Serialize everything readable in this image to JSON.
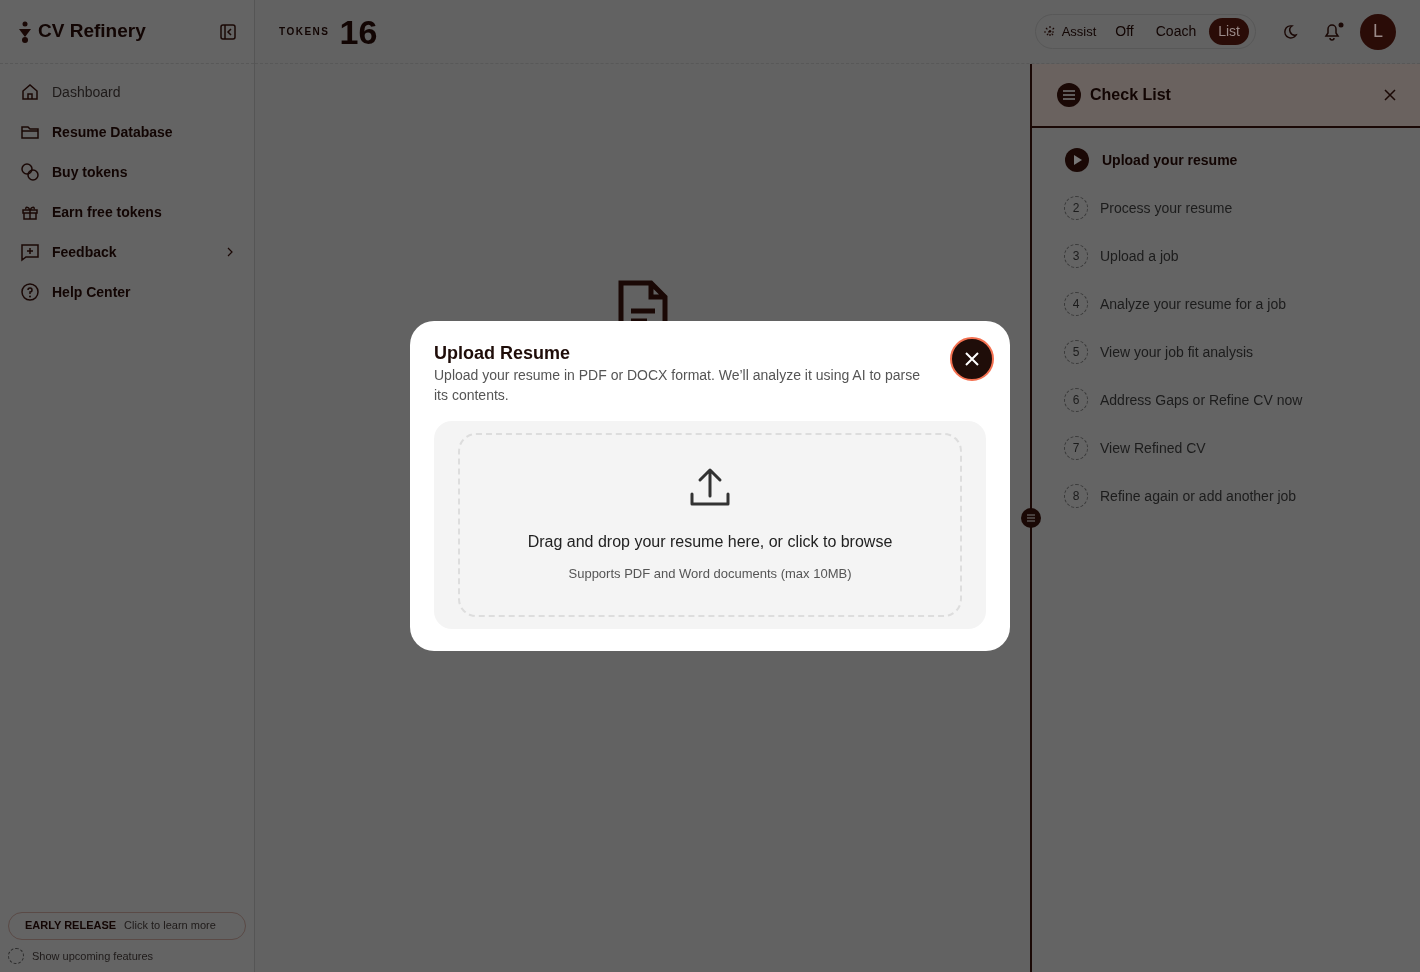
{
  "app": {
    "name": "CV Refinery"
  },
  "tokens": {
    "label": "TOKENS",
    "count": "16"
  },
  "sidebar": {
    "items": [
      {
        "label": "Dashboard",
        "selected": true,
        "has_submenu": false
      },
      {
        "label": "Resume Database",
        "selected": false,
        "has_submenu": false
      },
      {
        "label": "Buy tokens",
        "selected": false,
        "has_submenu": false
      },
      {
        "label": "Earn free tokens",
        "selected": false,
        "has_submenu": false
      },
      {
        "label": "Feedback",
        "selected": false,
        "has_submenu": true
      },
      {
        "label": "Help Center",
        "selected": false,
        "has_submenu": false
      }
    ]
  },
  "assist": {
    "label": "Assist",
    "options": [
      {
        "label": "Off",
        "selected": false
      },
      {
        "label": "Coach",
        "selected": false
      },
      {
        "label": "List",
        "selected": true
      }
    ]
  },
  "notifications": {
    "unread": true
  },
  "avatar": {
    "initial": "L"
  },
  "checklist": {
    "title": "Check List",
    "steps": [
      {
        "label": "Upload your resume",
        "current": true
      },
      {
        "number": "2",
        "label": "Process your resume",
        "current": false
      },
      {
        "number": "3",
        "label": "Upload a job",
        "current": false
      },
      {
        "number": "4",
        "label": "Analyze your resume for a job",
        "current": false
      },
      {
        "number": "5",
        "label": "View your job fit analysis",
        "current": false
      },
      {
        "number": "6",
        "label": "Address Gaps or Refine CV now",
        "current": false
      },
      {
        "number": "7",
        "label": "View Refined CV",
        "current": false
      },
      {
        "number": "8",
        "label": "Refine again or add another job",
        "current": false
      }
    ]
  },
  "footer": {
    "badge": "EARLY RELEASE",
    "link": "Click to learn more",
    "toggle": {
      "label": "Show upcoming features",
      "on": false
    }
  },
  "modal": {
    "title": "Upload Resume",
    "description": "Upload your resume in PDF or DOCX format. We’ll analyze it using AI to parse its contents.",
    "dropzone": {
      "title": "Drag and drop your resume here, or click to browse",
      "hint": "Supports PDF and Word documents (max 10MB)"
    }
  }
}
